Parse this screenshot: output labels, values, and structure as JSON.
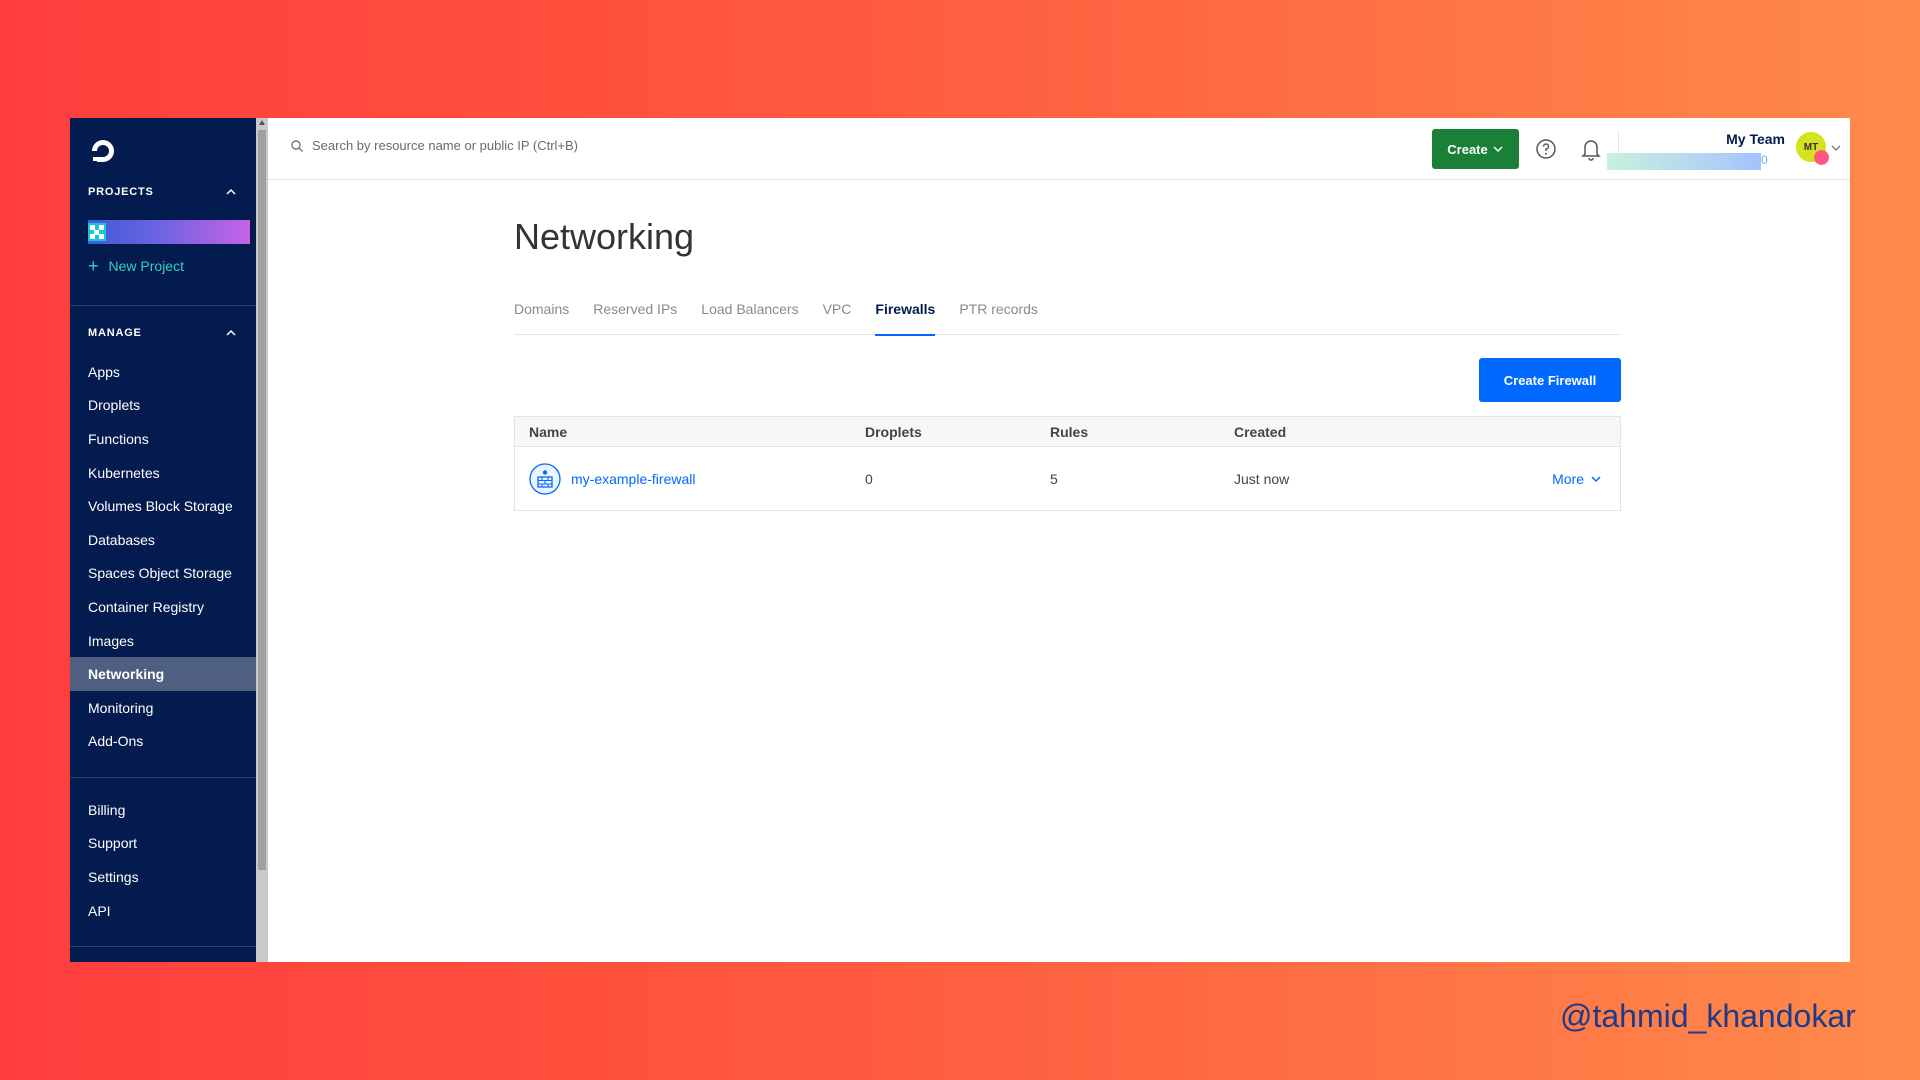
{
  "sidebar": {
    "projects_heading": "PROJECTS",
    "new_project": "New Project",
    "manage_heading": "MANAGE",
    "manage_items": [
      {
        "label": "Apps"
      },
      {
        "label": "Droplets"
      },
      {
        "label": "Functions"
      },
      {
        "label": "Kubernetes"
      },
      {
        "label": "Volumes Block Storage"
      },
      {
        "label": "Databases"
      },
      {
        "label": "Spaces Object Storage"
      },
      {
        "label": "Container Registry"
      },
      {
        "label": "Images"
      },
      {
        "label": "Networking",
        "active": true
      },
      {
        "label": "Monitoring"
      },
      {
        "label": "Add-Ons"
      }
    ],
    "account_items": [
      {
        "label": "Billing"
      },
      {
        "label": "Support"
      },
      {
        "label": "Settings"
      },
      {
        "label": "API"
      }
    ]
  },
  "topbar": {
    "search_placeholder": "Search by resource name or public IP (Ctrl+B)",
    "create_label": "Create",
    "team_name": "My Team",
    "team_count": "0",
    "avatar_initials": "MT"
  },
  "page": {
    "title": "Networking",
    "tabs": [
      {
        "label": "Domains"
      },
      {
        "label": "Reserved IPs"
      },
      {
        "label": "Load Balancers"
      },
      {
        "label": "VPC"
      },
      {
        "label": "Firewalls",
        "active": true
      },
      {
        "label": "PTR records"
      }
    ],
    "create_firewall_label": "Create Firewall",
    "table": {
      "columns": [
        "Name",
        "Droplets",
        "Rules",
        "Created"
      ],
      "rows": [
        {
          "name": "my-example-firewall",
          "droplets": "0",
          "rules": "5",
          "created": "Just now",
          "action": "More"
        }
      ]
    }
  },
  "colors": {
    "sidebar_bg": "#031b4e",
    "primary_blue": "#0069ff",
    "create_green": "#1a7f37",
    "project_accent": "#33d1c3"
  },
  "watermark": "@tahmid_khandokar"
}
